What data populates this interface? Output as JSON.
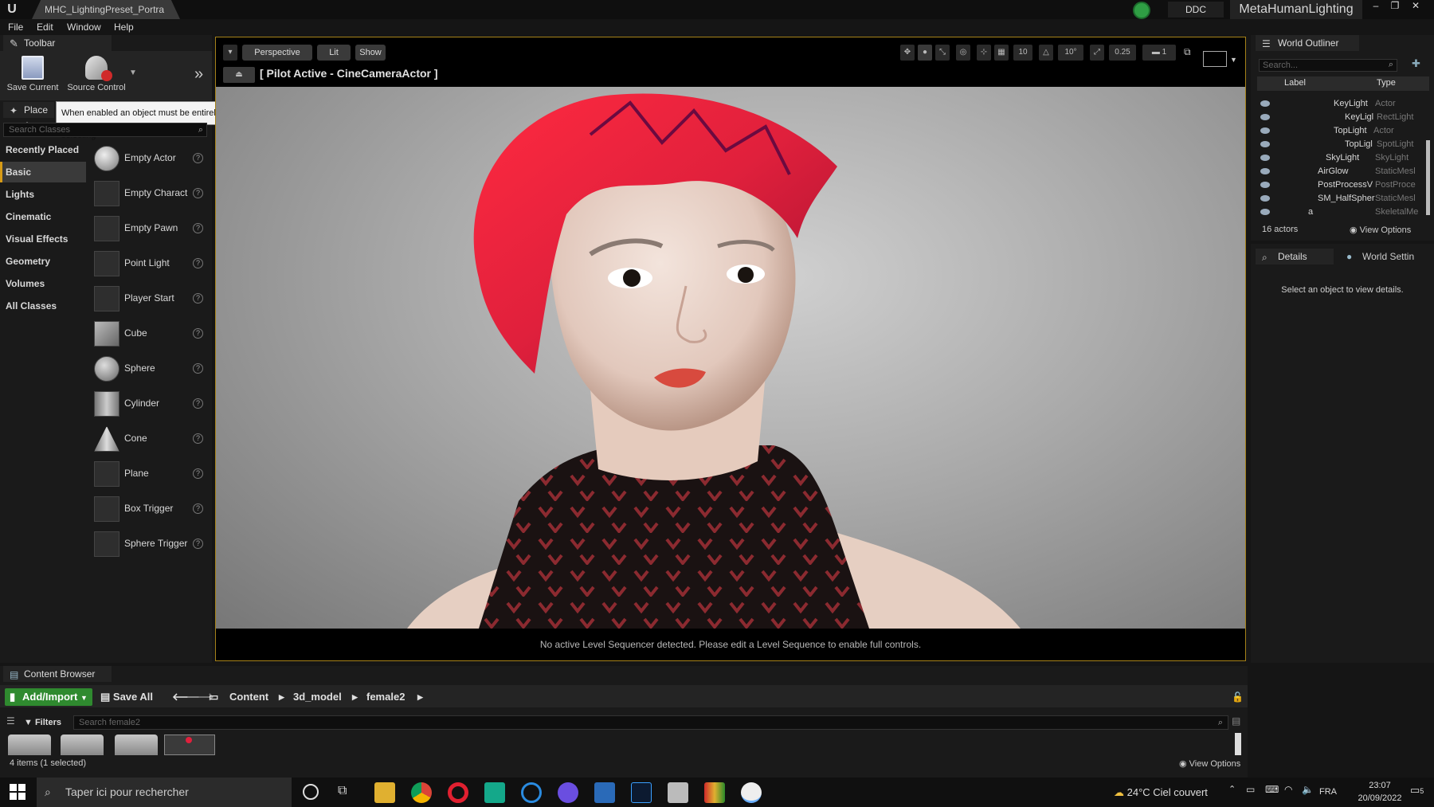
{
  "titlebar": {
    "tab_title": "MHC_LightingPreset_Portra",
    "ddc_label": "DDC",
    "project_name": "MetaHumanLighting",
    "window_buttons": [
      "–",
      "❐",
      "✕"
    ]
  },
  "menu": {
    "items": [
      "File",
      "Edit",
      "Window",
      "Help"
    ]
  },
  "toolbar": {
    "tab_label": "Toolbar",
    "save_current": "Save Current",
    "source_control": "Source Control"
  },
  "place_actors": {
    "tab_label": "Place A",
    "tooltip": "When enabled an object must be entirely encompassed by the selection box when marquee box selecting",
    "search_placeholder": "Search Classes",
    "categories": [
      "Recently Placed",
      "Basic",
      "Lights",
      "Cinematic",
      "Visual Effects",
      "Geometry",
      "Volumes",
      "All Classes"
    ],
    "active_category": "Basic",
    "items": [
      "Empty Actor",
      "Empty Charact",
      "Empty Pawn",
      "Point Light",
      "Player Start",
      "Cube",
      "Sphere",
      "Cylinder",
      "Cone",
      "Plane",
      "Box Trigger",
      "Sphere Trigger"
    ]
  },
  "viewport": {
    "perspective": "Perspective",
    "lit": "Lit",
    "show": "Show",
    "grid_snap": "10",
    "rotation_snap": "10°",
    "scale_snap": "0.25",
    "camera_speed": "1",
    "pilot_label": "[ Pilot Active - CineCameraActor ]",
    "footer_message": "No active Level Sequencer detected. Please edit a Level Sequence to enable full controls."
  },
  "outliner": {
    "tab_label": "World Outliner",
    "search_placeholder": "Search...",
    "col_label": "Label",
    "col_type": "Type",
    "rows": [
      {
        "name": "KeyLight",
        "type": "Actor"
      },
      {
        "name": "KeyLigl",
        "type": "RectLight"
      },
      {
        "name": "TopLight",
        "type": "Actor"
      },
      {
        "name": "TopLigl",
        "type": "SpotLight"
      },
      {
        "name": "SkyLight",
        "type": "SkyLight"
      },
      {
        "name": "AirGlow",
        "type": "StaticMesl"
      },
      {
        "name": "PostProcessV",
        "type": "PostProce"
      },
      {
        "name": "SM_HalfSpher",
        "type": "StaticMesl"
      },
      {
        "name": "a",
        "type": "SkeletalMe"
      }
    ],
    "actor_count": "16 actors",
    "view_options": "View Options"
  },
  "details": {
    "tab_label": "Details",
    "world_settings_label": "World Settin",
    "empty_message": "Select an object to view details."
  },
  "content_browser": {
    "tab_label": "Content Browser",
    "add_import": "Add/Import",
    "save_all": "Save All",
    "breadcrumbs": [
      "Content",
      "3d_model",
      "female2"
    ],
    "filters": "Filters",
    "search_placeholder": "Search female2",
    "status": "4 items (1 selected)",
    "view_options": "View Options"
  },
  "taskbar": {
    "search_placeholder": "Taper ici pour rechercher",
    "weather": "24°C  Ciel couvert",
    "language": "FRA",
    "time": "23:07",
    "date": "20/09/2022",
    "notification_count": "5"
  },
  "colors": {
    "accent": "#d69a16",
    "add_import_green": "#2f8a2f",
    "hair_red": "#e0203c"
  }
}
